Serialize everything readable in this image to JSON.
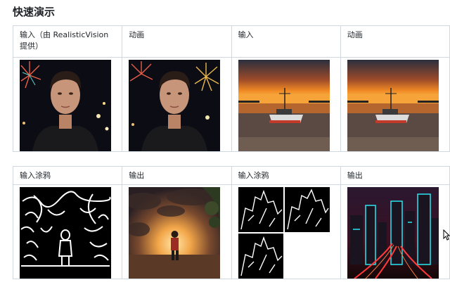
{
  "section_title": "快速演示",
  "table1": {
    "headers": [
      "输入（由 RealisticVision 提供）",
      "动画",
      "输入",
      "动画"
    ],
    "images": [
      "portrait-fireworks",
      "portrait-fireworks-animated",
      "boat-sunset",
      "boat-sunset-animated"
    ]
  },
  "table2": {
    "headers": [
      "输入涂鸦",
      "输出",
      "输入涂鸦",
      "输出"
    ],
    "images": [
      "scribble-person",
      "person-sunset-output",
      "scribble-city",
      "neon-city-output"
    ]
  },
  "colors": {
    "border": "#d0d7de",
    "text": "#1f2328",
    "neon": "#29e6f0"
  }
}
